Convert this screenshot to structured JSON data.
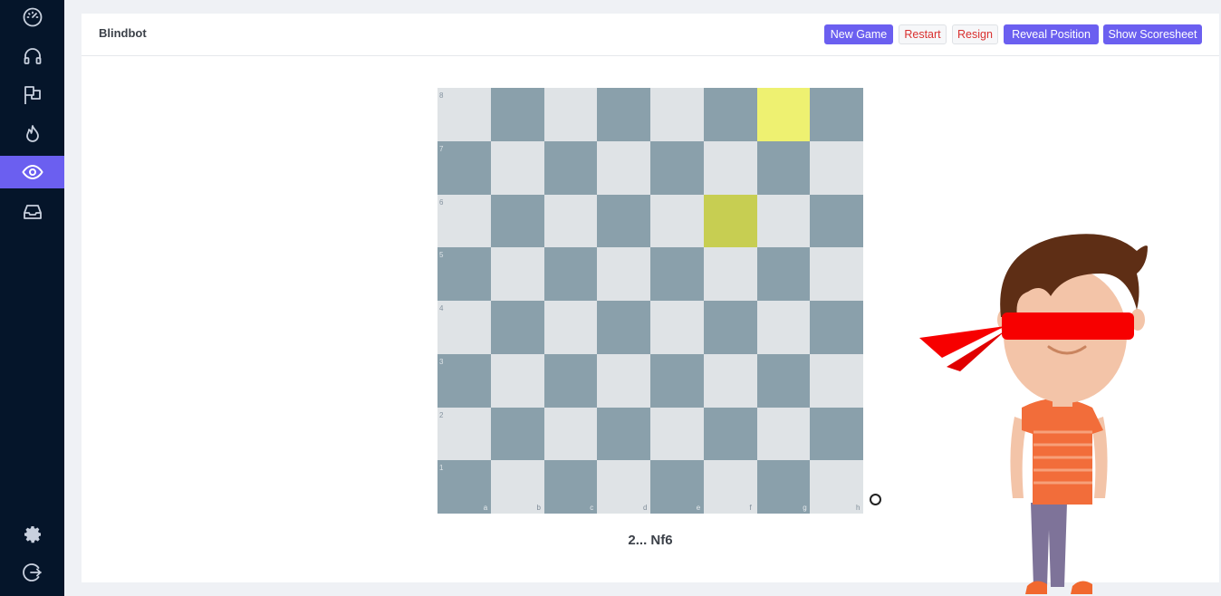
{
  "app": {
    "title": "Blindbot"
  },
  "sidebar": {
    "items": [
      {
        "icon": "speedometer-icon"
      },
      {
        "icon": "headphones-icon"
      },
      {
        "icon": "flags-icon"
      },
      {
        "icon": "flame-icon"
      },
      {
        "icon": "eye-icon",
        "active": true
      },
      {
        "icon": "inbox-icon"
      }
    ],
    "bottom": [
      {
        "icon": "gear-icon"
      },
      {
        "icon": "logout-icon"
      }
    ]
  },
  "toolbar": {
    "new_game": "New Game",
    "restart": "Restart",
    "resign": "Resign",
    "reveal": "Reveal Position",
    "scoresheet": "Show Scoresheet"
  },
  "board": {
    "ranks": [
      "8",
      "7",
      "6",
      "5",
      "4",
      "3",
      "2",
      "1"
    ],
    "files": [
      "a",
      "b",
      "c",
      "d",
      "e",
      "f",
      "g",
      "h"
    ],
    "highlight_from": "g8",
    "highlight_to": "f6",
    "colors": {
      "light": "#dfe3e6",
      "dark": "#8aa0ab",
      "from": "#eef171",
      "to": "#c7ce52"
    }
  },
  "last_move": "2... Nf6"
}
